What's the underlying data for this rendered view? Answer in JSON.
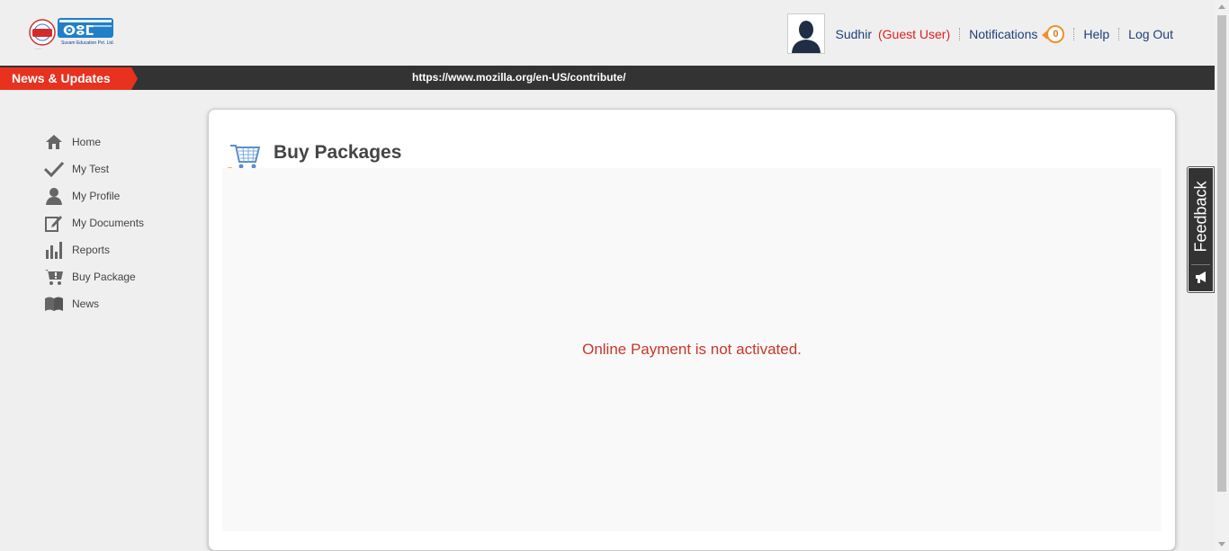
{
  "header": {
    "logo_icon": "suvam-logo",
    "logo_subtitle": "Suvam Education Pvt. Ltd.",
    "user_name": "Sudhir",
    "user_role": "(Guest User)",
    "notifications_label": "Notifications",
    "notifications_count": "0",
    "help_label": "Help",
    "logout_label": "Log Out"
  },
  "newsbar": {
    "tag": "News & Updates",
    "ticker_text": "https://www.mozilla.org/en-US/contribute/"
  },
  "sidebar": {
    "items": [
      {
        "label": "Home",
        "icon": "home-icon"
      },
      {
        "label": "My Test",
        "icon": "check-icon"
      },
      {
        "label": "My Profile",
        "icon": "user-icon"
      },
      {
        "label": "My Documents",
        "icon": "edit-document-icon"
      },
      {
        "label": "Reports",
        "icon": "bar-chart-icon"
      },
      {
        "label": "Buy Package",
        "icon": "cart-icon"
      },
      {
        "label": "News",
        "icon": "book-icon"
      }
    ]
  },
  "main": {
    "title": "Buy Packages",
    "message": "Online Payment is not activated."
  },
  "feedback": {
    "label": "Feedback",
    "icon": "megaphone-icon"
  },
  "colors": {
    "accent_red": "#e8311e",
    "link_blue": "#1e3f7a",
    "message_red": "#c8382c",
    "badge_orange": "#f0902a"
  }
}
